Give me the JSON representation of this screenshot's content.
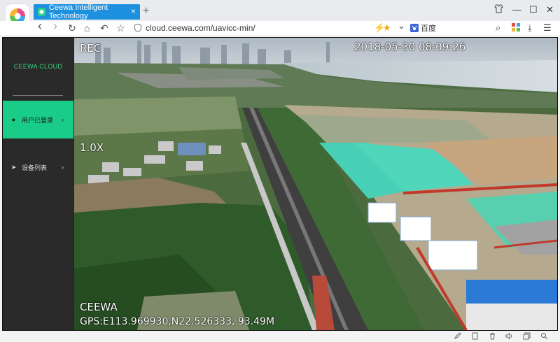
{
  "browser": {
    "tab": {
      "title": "Ceewa Intelligent Technology",
      "close": "×"
    },
    "new_tab": "+",
    "window_controls": {
      "skin": "👕",
      "minimize": "—",
      "maximize": "☐",
      "close": "✕"
    },
    "nav": {
      "back": "‹",
      "forward": "›",
      "reload": "↻",
      "home": "⌂",
      "undo": "↶",
      "favorite": "☆"
    },
    "address": {
      "url": "cloud.ceewa.com/uavicc-min/"
    },
    "extras": {
      "flash": "⚡",
      "star": "★",
      "dropdown": "⌄"
    },
    "search": {
      "engine_label": "百度"
    },
    "right_tools": {
      "search": "⌕",
      "apps": "▦",
      "download": "⤓",
      "menu": "☰"
    }
  },
  "sidebar": {
    "brand": "CEEWA CLOUD",
    "items": [
      {
        "label": "用户已登录",
        "icon": "user-icon",
        "active": true
      },
      {
        "label": "设备列表",
        "icon": "send-icon",
        "active": false
      }
    ],
    "chevron": "›",
    "user_glyph": "●",
    "send_glyph": "➤"
  },
  "video": {
    "rec": "REC",
    "timestamp": "2018-05-30 08:09:26",
    "zoom": "1.0X",
    "watermark": "CEEWA",
    "gps": "GPS:E113.969930,N22.526333, 93.49M"
  },
  "statusbar": {
    "icons": [
      "rocket-icon",
      "tablet-icon",
      "trash-icon",
      "speaker-icon",
      "window-icon",
      "search-icon"
    ],
    "glyphs": {
      "rocket": "🚀",
      "tablet": "▭",
      "trash": "🗑",
      "speaker": "🔈",
      "window": "❐",
      "search": "⌕"
    }
  },
  "colors": {
    "tab_blue": "#1e90e0",
    "accent_green": "#19cc88",
    "brand_green": "#39d27c",
    "sidebar_bg": "#2a2a2a"
  }
}
